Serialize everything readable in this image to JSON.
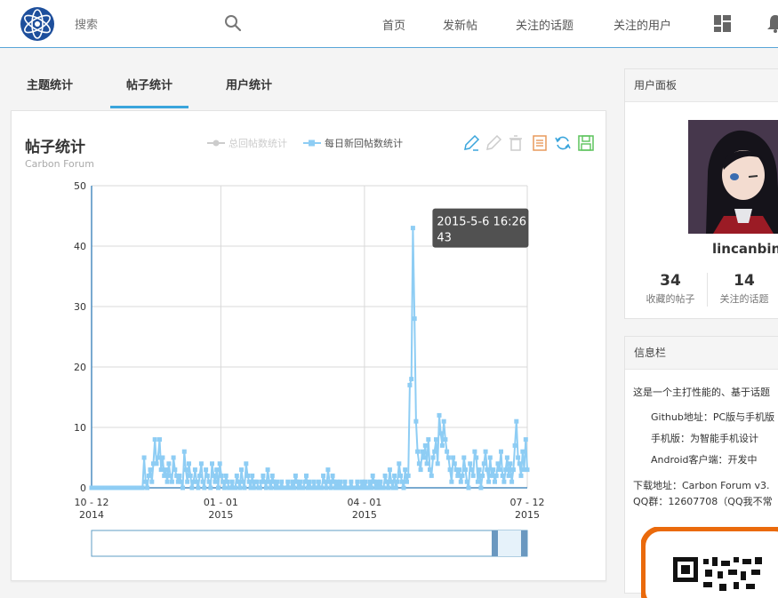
{
  "header": {
    "search_placeholder": "搜索",
    "nav": [
      "首页",
      "发新帖",
      "关注的话题",
      "关注的用户"
    ]
  },
  "tabs": [
    "主题统计",
    "帖子统计",
    "用户统计"
  ],
  "chart_panel": {
    "title": "帖子统计",
    "subtitle": "Carbon Forum",
    "legend": [
      {
        "label": "总回帖数统计",
        "active": false
      },
      {
        "label": "每日新回帖数统计",
        "active": true
      }
    ],
    "toolbox_icons": [
      "edit-pencil-icon",
      "pencil-disabled-icon",
      "trash-disabled-icon",
      "data-view-icon",
      "refresh-icon",
      "save-image-icon"
    ],
    "colors": {
      "series": "#8ecdf4",
      "accent": "#3aa5dc",
      "muted": "#cccccc"
    }
  },
  "chart_data": {
    "type": "line",
    "title": "帖子统计",
    "subtitle": "Carbon Forum",
    "x": {
      "start": "2014-10-12",
      "end": "2015-07-12",
      "tick_labels": [
        [
          "10 - 12",
          "2014"
        ],
        [
          "01 - 01",
          "2015"
        ],
        [
          "04 - 01",
          "2015"
        ],
        [
          "07 - 12",
          "2015"
        ]
      ]
    },
    "ylim": [
      0,
      50
    ],
    "yticks": [
      0,
      10,
      20,
      30,
      40,
      50
    ],
    "series": [
      {
        "name": "每日新回帖数统计",
        "values": [
          0,
          0,
          0,
          0,
          0,
          0,
          0,
          0,
          0,
          0,
          0,
          0,
          0,
          0,
          0,
          0,
          0,
          0,
          0,
          0,
          0,
          0,
          0,
          0,
          0,
          0,
          0,
          0,
          0,
          0,
          0,
          0,
          0,
          0,
          5,
          1,
          0,
          2,
          3,
          1,
          4,
          8,
          4,
          5,
          8,
          3,
          5,
          2,
          3,
          1,
          4,
          2,
          1,
          5,
          3,
          2,
          1,
          2,
          1,
          0,
          6,
          3,
          1,
          4,
          2,
          0,
          1,
          3,
          1,
          0,
          2,
          4,
          1,
          0,
          3,
          2,
          1,
          0,
          4,
          2,
          1,
          3,
          0,
          4,
          2,
          1,
          0,
          2,
          1,
          0,
          0,
          1,
          0,
          0,
          2,
          1,
          0,
          3,
          1,
          0,
          4,
          2,
          1,
          0,
          2,
          0,
          1,
          1,
          0,
          0,
          1,
          2,
          1,
          0,
          3,
          1,
          0,
          2,
          1,
          0,
          1,
          0,
          0,
          1,
          0,
          0,
          0,
          1,
          0,
          0,
          1,
          0,
          2,
          1,
          0,
          1,
          0,
          0,
          1,
          2,
          0,
          1,
          0,
          0,
          1,
          0,
          0,
          1,
          0,
          0,
          2,
          1,
          0,
          3,
          1,
          0,
          2,
          1,
          0,
          1,
          0,
          1,
          0,
          0,
          1,
          0,
          0,
          0,
          1,
          0,
          0,
          0,
          1,
          0,
          0,
          1,
          0,
          1,
          0,
          0,
          1,
          0,
          2,
          1,
          0,
          1,
          0,
          1,
          0,
          0,
          2,
          1,
          0,
          3,
          1,
          0,
          2,
          0,
          1,
          4,
          2,
          1,
          0,
          3,
          1,
          2,
          17,
          18,
          43,
          28,
          11,
          6,
          4,
          3,
          6,
          5,
          7,
          4,
          8,
          3,
          2,
          5,
          6,
          8,
          4,
          12,
          9,
          7,
          11,
          8,
          6,
          5,
          3,
          1,
          5,
          4,
          3,
          2,
          3,
          1,
          2,
          5,
          3,
          1,
          0,
          4,
          3,
          2,
          6,
          5,
          1,
          3,
          0,
          2,
          4,
          6,
          3,
          1,
          5,
          2,
          3,
          1,
          2,
          4,
          3,
          6,
          2,
          1,
          3,
          5,
          2,
          4,
          1,
          3,
          7,
          11,
          5,
          4,
          2,
          6,
          3,
          8,
          3
        ]
      }
    ],
    "tooltip": {
      "date": "2015-5-6 16:26",
      "value": "43"
    },
    "legend_position": "top-center",
    "grid": true
  },
  "user_panel": {
    "header": "用户面板",
    "username": "lincanbin",
    "stats": [
      {
        "value": "34",
        "label": "收藏的帖子"
      },
      {
        "value": "14",
        "label": "关注的话题"
      }
    ]
  },
  "info_panel": {
    "header": "信息栏",
    "lines": [
      "这是一个主打性能的、基于话题",
      "Github地址：PC版与手机版",
      "手机版：为智能手机设计",
      "Android客户端：开发中",
      "下载地址：Carbon Forum v3.",
      "QQ群：12607708（QQ我不常"
    ]
  }
}
